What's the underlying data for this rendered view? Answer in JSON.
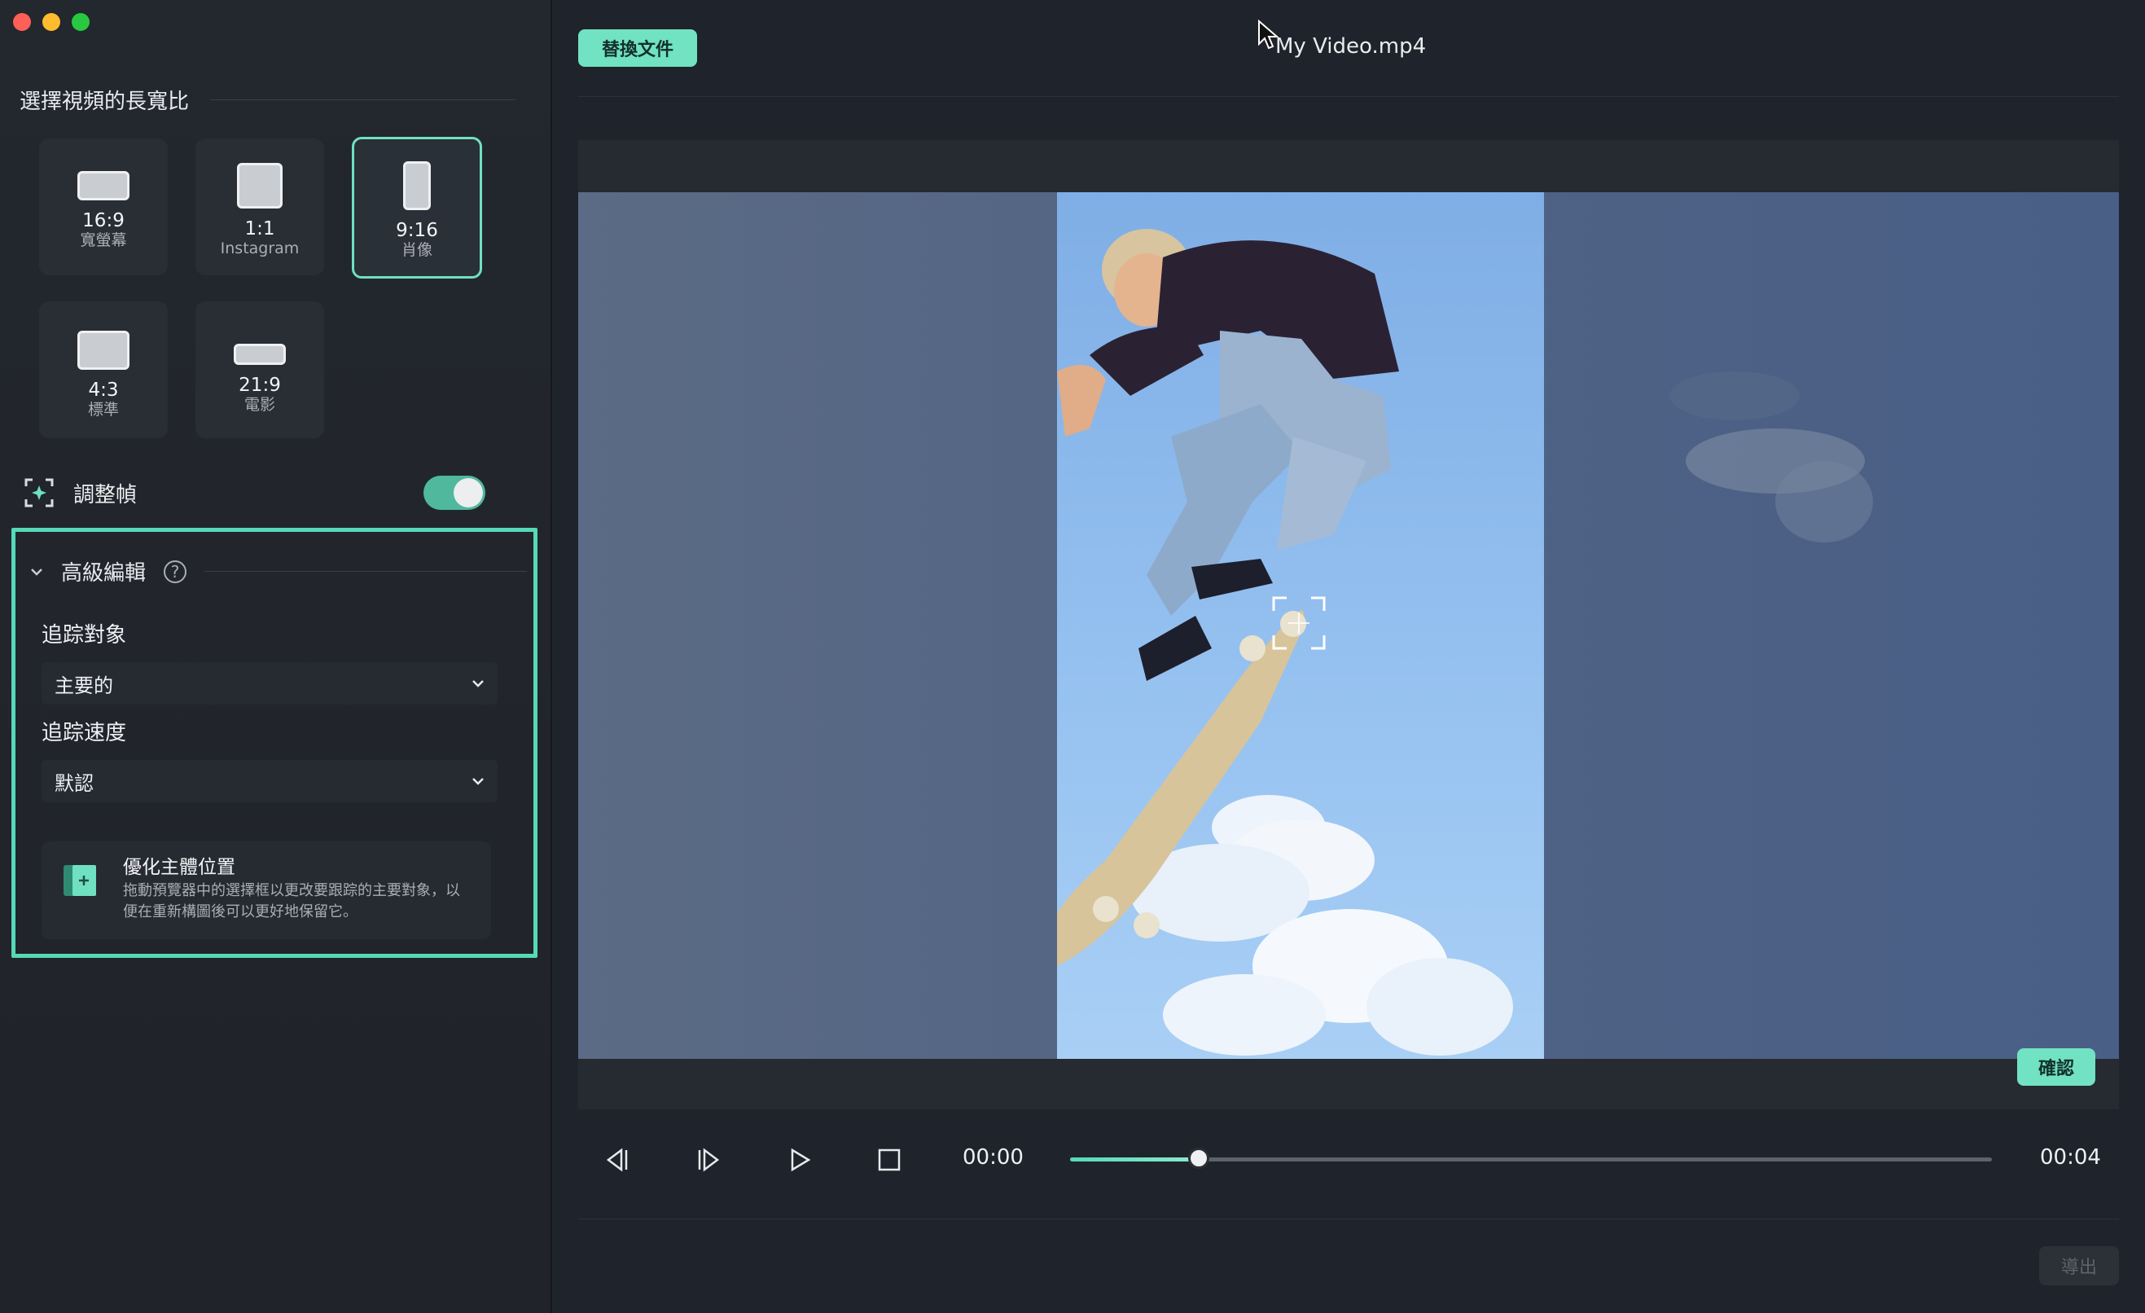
{
  "window": {
    "file_title": "My Video.mp4",
    "replace_button": "替換文件",
    "confirm_button": "確認",
    "export_button": "導出"
  },
  "sidebar": {
    "aspect_title": "選擇視頻的長寬比",
    "ratios": [
      {
        "value": "16:9",
        "sub": "寬螢幕",
        "selected": false
      },
      {
        "value": "1:1",
        "sub": "Instagram",
        "selected": false
      },
      {
        "value": "9:16",
        "sub": "肖像",
        "selected": true
      },
      {
        "value": "4:3",
        "sub": "標準",
        "selected": false
      },
      {
        "value": "21:9",
        "sub": "電影",
        "selected": false
      }
    ],
    "adjust_frame": {
      "label": "調整幀",
      "enabled": true
    },
    "advanced": {
      "title": "高級編輯",
      "track_target_label": "追踪對象",
      "track_target_value": "主要的",
      "track_speed_label": "追踪速度",
      "track_speed_value": "默認",
      "optimize_title": "優化主體位置",
      "optimize_desc": "拖動預覽器中的選擇框以更改要跟踪的主要對象，以便在重新構圖後可以更好地保留它。"
    }
  },
  "player": {
    "current_time": "00:00",
    "total_time": "00:04",
    "progress": 0.14
  },
  "colors": {
    "accent": "#71e2c2",
    "selected_border": "#6fe0c0",
    "highlight_box": "#56d9b8",
    "background": "#1f232b"
  },
  "icons": [
    "prev-frame-icon",
    "next-frame-icon",
    "play-icon",
    "stop-icon",
    "help-icon",
    "chevron-down-icon",
    "adjust-frame-icon",
    "focus-target-icon",
    "optimize-icon",
    "cursor-icon"
  ]
}
